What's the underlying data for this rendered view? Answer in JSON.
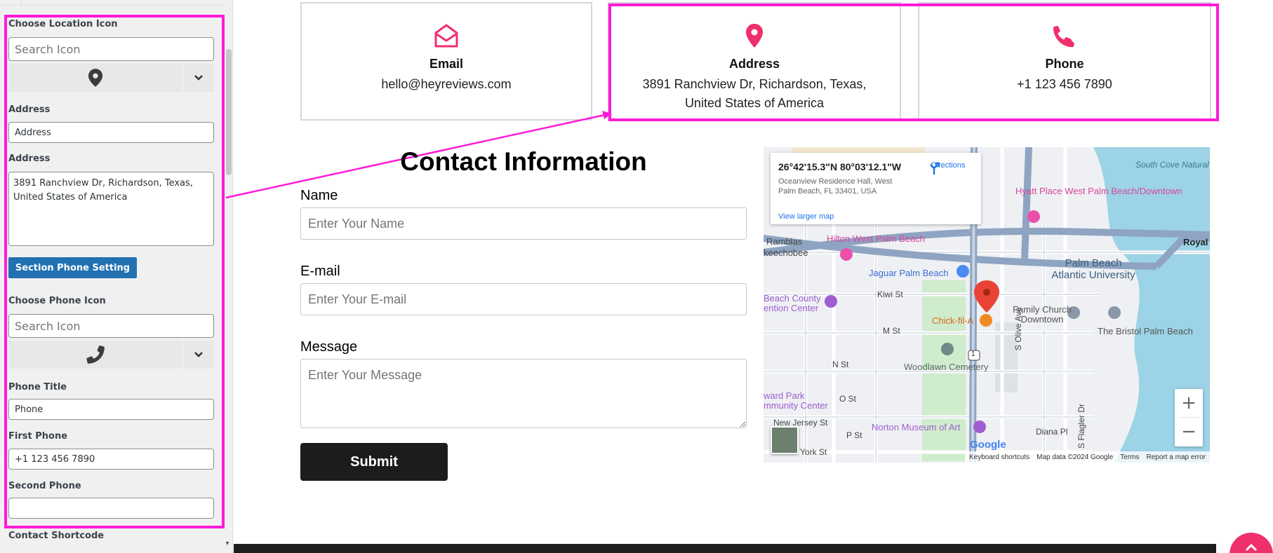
{
  "panel": {
    "location_icon_label": "Choose Location Icon",
    "location_icon_search_placeholder": "Search Icon",
    "location_selected_icon": "map-pin-icon",
    "address_title_label": "Address",
    "address_title_value": "Address",
    "address_label": "Address",
    "address_value": "3891 Ranchview Dr, Richardson, Texas, United States of America",
    "section_phone_button": "Section Phone Setting",
    "phone_icon_label": "Choose Phone Icon",
    "phone_icon_search_placeholder": "Search Icon",
    "phone_selected_icon": "phone-icon",
    "phone_title_label": "Phone Title",
    "phone_title_value": "Phone",
    "first_phone_label": "First Phone",
    "first_phone_value": "+1 123 456 7890",
    "second_phone_label": "Second Phone",
    "second_phone_value": "",
    "contact_shortcode_label": "Contact Shortcode"
  },
  "cards": [
    {
      "icon": "envelope-open-icon",
      "title": "Email",
      "text": "hello@heyreviews.com"
    },
    {
      "icon": "map-pin-icon",
      "title": "Address",
      "text": "3891 Ranchview Dr, Richardson, Texas, United States of America"
    },
    {
      "icon": "phone-icon",
      "title": "Phone",
      "text": "+1 123 456 7890"
    }
  ],
  "form": {
    "title": "Contact Information",
    "name_label": "Name",
    "name_placeholder": "Enter Your Name",
    "email_label": "E-mail",
    "email_placeholder": "Enter Your E-mail",
    "message_label": "Message",
    "message_placeholder": "Enter Your Message",
    "submit_label": "Submit"
  },
  "map": {
    "coordinates": "26°42'15.3\"N 80°03'12.1\"W",
    "address": "Oceanview Residence Hall, West Palm Beach, FL 33401, USA",
    "directions_label": "Directions",
    "larger_map_label": "View larger map",
    "zoom_in": "+",
    "zoom_out": "−",
    "logo": "Google",
    "footer_keyboard": "Keyboard shortcuts",
    "footer_mapdata": "Map data ©2024 Google",
    "footer_terms": "Terms",
    "footer_report": "Report a map error",
    "places": {
      "hyatt": "Hyatt Place West Palm Beach/Downtown",
      "south_cove": "South Cove Natural Area",
      "royal_park": "Royal P",
      "hilton": "Hilton West Palm Beach",
      "ramblas": "Ramblas",
      "keechobee": "keechobee",
      "jaguar": "Jaguar Palm Beach",
      "pba": "Palm Beach Atlantic University",
      "kiwi": "Kiwi St",
      "beach_county": "Beach County",
      "convention": "ention Center",
      "family_church": "Family Church Downtown",
      "m_st": "M St",
      "chickfila": "Chick-fil-A",
      "bristol": "The Bristol Palm Beach",
      "n_st": "N St",
      "woodlawn": "Woodlawn Cemetery",
      "s_olive": "S Olive Ave",
      "ward_park": "ward Park",
      "community": "mmunity Center",
      "o_st": "O St",
      "s_flagler": "S Flagler Dr",
      "new_jersey": "New Jersey St",
      "p_st": "P St",
      "norton": "Norton Museum of Art",
      "diana": "Diana Pl",
      "york": "York St",
      "route": "1"
    }
  },
  "colors": {
    "accent": "#f0306b",
    "highlight": "#ff1ad9",
    "wp_blue": "#2271b1",
    "submit_bg": "#1c1c1c"
  }
}
